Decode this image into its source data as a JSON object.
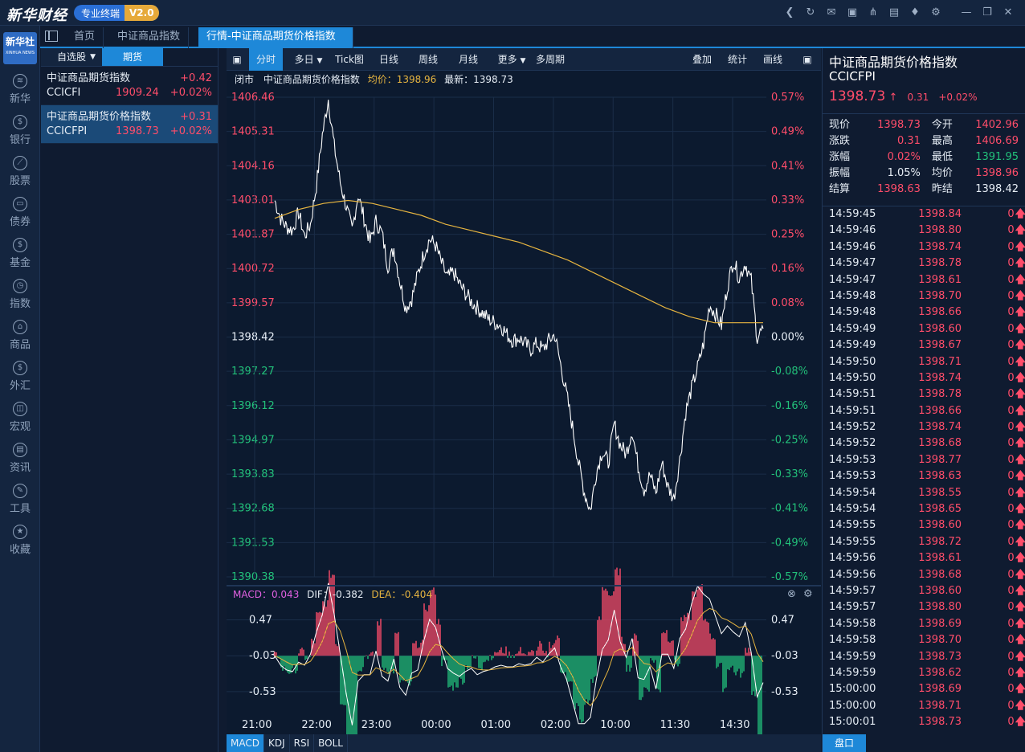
{
  "app": {
    "logo": "新华财经",
    "pro_label": "专业终端",
    "version": "V2.0"
  },
  "colors": {
    "up": "#ff4d6a",
    "down": "#22c07a",
    "accent": "#1e88d8",
    "avg_line": "#e6b440"
  },
  "topicons": [
    "back-icon",
    "refresh-icon",
    "mail-icon",
    "chat-icon",
    "share-icon",
    "note-icon",
    "shirt-icon",
    "gear-icon",
    "minimize-icon",
    "restore-icon",
    "close-icon"
  ],
  "nav": {
    "logo_line1": "新华社",
    "logo_line2": "XINHUA NEWS",
    "items": [
      "新华",
      "银行",
      "股票",
      "债券",
      "基金",
      "指数",
      "商品",
      "外汇",
      "宏观",
      "资讯",
      "工具",
      "收藏"
    ]
  },
  "tabs": [
    {
      "label": "首页"
    },
    {
      "label": "中证商品指数"
    },
    {
      "label": "行情-中证商品期货价格指数"
    }
  ],
  "watch": {
    "tabs": [
      "自选股",
      "期货"
    ],
    "items": [
      {
        "name": "中证商品期货指数",
        "change": "+0.42",
        "code": "CCICFI",
        "price": "1909.24",
        "pct": "+0.02%"
      },
      {
        "name": "中证商品期货价格指数",
        "change": "+0.31",
        "code": "CCICFPI",
        "price": "1398.73",
        "pct": "+0.02%"
      }
    ]
  },
  "toolbar": {
    "items": [
      "分时",
      "多日",
      "Tick图",
      "日线",
      "周线",
      "月线",
      "更多",
      "多周期"
    ],
    "right": [
      "叠加",
      "统计",
      "画线"
    ]
  },
  "info": {
    "status": "闭市",
    "name": "中证商品期货价格指数",
    "avg_label": "均价：1398.96",
    "latest_label": "最新：1398.73"
  },
  "macd_info": {
    "macd": "MACD：0.043",
    "dif": "DIF：-0.382",
    "dea": "DEA：-0.404"
  },
  "bottom_tabs": [
    "MACD",
    "KDJ",
    "RSI",
    "BOLL"
  ],
  "right": {
    "title": "中证商品期货价格指数",
    "code": "CCICFPI",
    "price": "1398.73",
    "change": "0.31",
    "pct": "+0.02%",
    "stats": [
      {
        "l": "现价",
        "v": "1398.73",
        "c": "up",
        "l2": "今开",
        "v2": "1402.96",
        "c2": "up"
      },
      {
        "l": "涨跌",
        "v": "0.31",
        "c": "up",
        "l2": "最高",
        "v2": "1406.69",
        "c2": "up"
      },
      {
        "l": "涨幅",
        "v": "0.02%",
        "c": "up",
        "l2": "最低",
        "v2": "1391.95",
        "c2": "down"
      },
      {
        "l": "振幅",
        "v": "1.05%",
        "c": "flat",
        "l2": "均价",
        "v2": "1398.96",
        "c2": "up"
      },
      {
        "l": "结算",
        "v": "1398.63",
        "c": "up",
        "l2": "昨结",
        "v2": "1398.42",
        "c2": "flat"
      }
    ],
    "ticks": [
      [
        "14:59:45",
        "1398.84",
        "0"
      ],
      [
        "14:59:46",
        "1398.80",
        "0"
      ],
      [
        "14:59:46",
        "1398.74",
        "0"
      ],
      [
        "14:59:47",
        "1398.78",
        "0"
      ],
      [
        "14:59:47",
        "1398.61",
        "0"
      ],
      [
        "14:59:48",
        "1398.70",
        "0"
      ],
      [
        "14:59:48",
        "1398.66",
        "0"
      ],
      [
        "14:59:49",
        "1398.60",
        "0"
      ],
      [
        "14:59:49",
        "1398.67",
        "0"
      ],
      [
        "14:59:50",
        "1398.71",
        "0"
      ],
      [
        "14:59:50",
        "1398.74",
        "0"
      ],
      [
        "14:59:51",
        "1398.78",
        "0"
      ],
      [
        "14:59:51",
        "1398.66",
        "0"
      ],
      [
        "14:59:52",
        "1398.74",
        "0"
      ],
      [
        "14:59:52",
        "1398.68",
        "0"
      ],
      [
        "14:59:53",
        "1398.77",
        "0"
      ],
      [
        "14:59:53",
        "1398.63",
        "0"
      ],
      [
        "14:59:54",
        "1398.55",
        "0"
      ],
      [
        "14:59:54",
        "1398.65",
        "0"
      ],
      [
        "14:59:55",
        "1398.60",
        "0"
      ],
      [
        "14:59:55",
        "1398.72",
        "0"
      ],
      [
        "14:59:56",
        "1398.61",
        "0"
      ],
      [
        "14:59:56",
        "1398.68",
        "0"
      ],
      [
        "14:59:57",
        "1398.60",
        "0"
      ],
      [
        "14:59:57",
        "1398.80",
        "0"
      ],
      [
        "14:59:58",
        "1398.69",
        "0"
      ],
      [
        "14:59:58",
        "1398.70",
        "0"
      ],
      [
        "14:59:59",
        "1398.73",
        "0"
      ],
      [
        "14:59:59",
        "1398.62",
        "0"
      ],
      [
        "15:00:00",
        "1398.69",
        "0"
      ],
      [
        "15:00:00",
        "1398.71",
        "0"
      ],
      [
        "15:00:01",
        "1398.73",
        "0"
      ]
    ],
    "pankou": "盘口"
  },
  "chart_data": {
    "type": "line",
    "price_ticks": [
      "1406.46",
      "1405.31",
      "1404.16",
      "1403.01",
      "1401.87",
      "1400.72",
      "1399.57",
      "1398.42",
      "1397.27",
      "1396.12",
      "1394.97",
      "1393.83",
      "1392.68",
      "1391.53",
      "1390.38"
    ],
    "pct_ticks": [
      "0.57%",
      "0.49%",
      "0.41%",
      "0.33%",
      "0.25%",
      "0.16%",
      "0.08%",
      "0.00%",
      "-0.08%",
      "-0.16%",
      "-0.25%",
      "-0.33%",
      "-0.41%",
      "-0.49%",
      "-0.57%"
    ],
    "ylim": [
      1390.38,
      1406.46
    ],
    "time_labels": [
      "21:00",
      "22:00",
      "23:00",
      "00:00",
      "01:00",
      "02:00",
      "10:00",
      "11:30",
      "14:30"
    ],
    "series": [
      {
        "values": [
          1403.0,
          1402.4,
          1402.1,
          1402.0,
          1402.6,
          1401.8,
          1402.2,
          1403.5,
          1405.2,
          1406.4,
          1404.8,
          1403.6,
          1402.8,
          1402.0,
          1403.2,
          1402.4,
          1401.6,
          1402.3,
          1401.9,
          1400.8,
          1401.4,
          1400.3,
          1399.4,
          1399.7,
          1400.5,
          1401.2,
          1401.7,
          1401.5,
          1400.9,
          1400.4,
          1400.6,
          1400.2,
          1399.9,
          1399.6,
          1399.4,
          1399.2,
          1399.0,
          1398.9,
          1398.8,
          1398.5,
          1398.3,
          1398.4,
          1398.2,
          1398.0,
          1398.2,
          1398.0,
          1398.3,
          1398.5,
          1397.5,
          1396.5,
          1395.4,
          1394.2,
          1393.2,
          1392.6,
          1393.9,
          1394.6,
          1394.2,
          1395.5,
          1394.8,
          1394.5,
          1395.3,
          1394.1,
          1393.3,
          1393.8,
          1393.2,
          1394.2,
          1393.4,
          1393.0,
          1394.3,
          1395.9,
          1396.7,
          1397.4,
          1398.2,
          1399.5,
          1399.2,
          1398.8,
          1400.1,
          1401.0,
          1400.4,
          1400.9,
          1400.3,
          1398.4,
          1398.7
        ]
      },
      {
        "values": [
          1402.4,
          1402.7,
          1402.9,
          1403.0,
          1402.9,
          1402.7,
          1402.5,
          1402.2,
          1402.0,
          1401.8,
          1401.6,
          1401.3,
          1401.0,
          1400.6,
          1400.2,
          1399.8,
          1399.4,
          1399.1,
          1398.9,
          1398.9,
          1398.9
        ]
      }
    ],
    "macd": {
      "ticks": [
        "0.47",
        "-0.03",
        "-0.53"
      ],
      "ylim": [
        -0.8,
        0.7
      ]
    }
  }
}
